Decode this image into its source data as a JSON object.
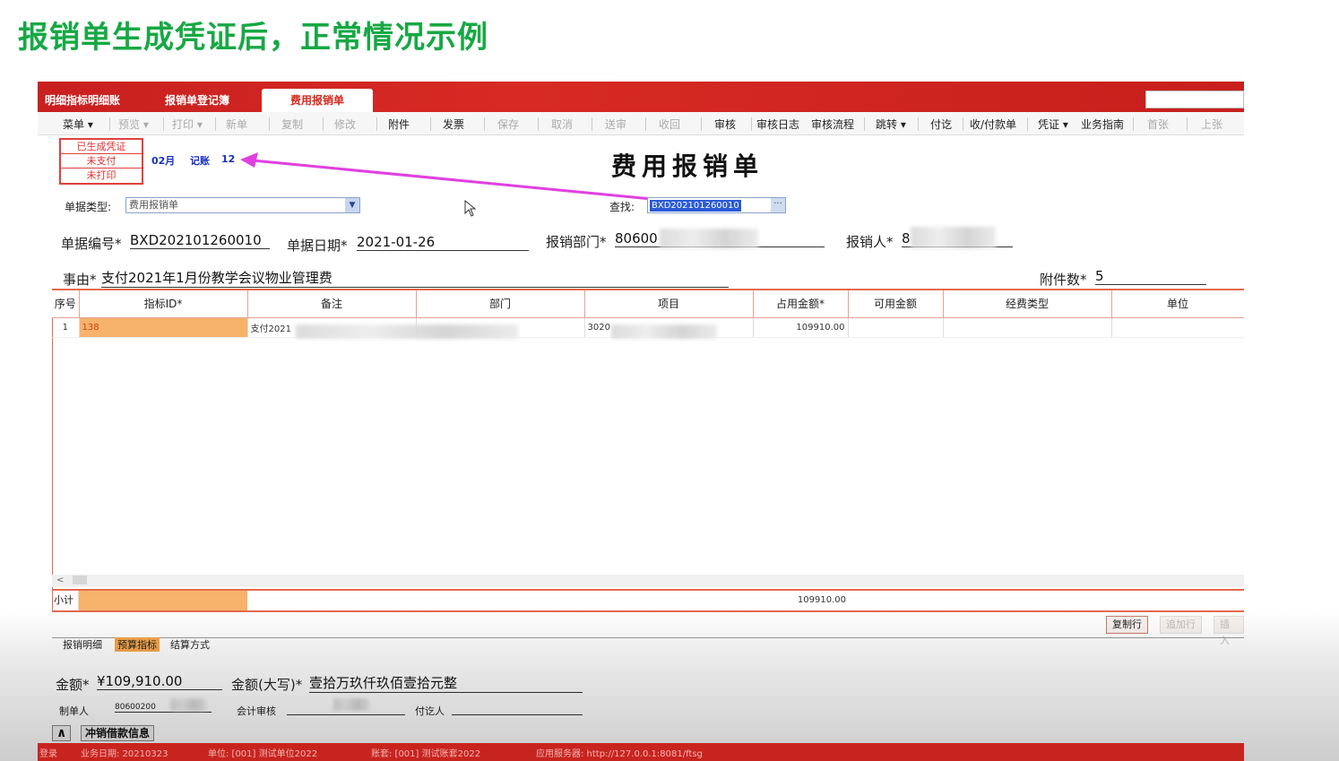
{
  "slide": {
    "title": "报销单生成凭证后，正常情况示例"
  },
  "tabs": [
    "明细指标明细账",
    "报销单登记簿",
    "费用报销单"
  ],
  "toolbar": {
    "items": [
      {
        "label": "菜单 ▾",
        "enabled": true
      },
      {
        "label": "预览 ▾",
        "enabled": false
      },
      {
        "label": "打印 ▾",
        "enabled": false
      },
      {
        "label": "新单",
        "enabled": false
      },
      {
        "label": "复制",
        "enabled": false
      },
      {
        "label": "修改",
        "enabled": false
      },
      {
        "label": "附件",
        "enabled": true
      },
      {
        "label": "发票",
        "enabled": true
      },
      {
        "label": "保存",
        "enabled": false
      },
      {
        "label": "取消",
        "enabled": false
      },
      {
        "label": "送审",
        "enabled": false
      },
      {
        "label": "收回",
        "enabled": false
      },
      {
        "label": "审核",
        "enabled": true
      },
      {
        "label": "审核日志",
        "enabled": true
      },
      {
        "label": "审核流程",
        "enabled": true
      },
      {
        "label": "跳转 ▾",
        "enabled": true
      },
      {
        "label": "付讫",
        "enabled": true
      },
      {
        "label": "收/付款单",
        "enabled": true
      },
      {
        "label": "凭证 ▾",
        "enabled": true
      },
      {
        "label": "业务指南",
        "enabled": true
      },
      {
        "label": "首张",
        "enabled": false
      },
      {
        "label": "上张",
        "enabled": false
      }
    ]
  },
  "status": [
    "已生成凭证",
    "未支付",
    "未打印"
  ],
  "voucher": {
    "month": "02月",
    "type": "记账",
    "number": "12"
  },
  "form": {
    "title": "费用报销单",
    "doc_type_label": "单据类型:",
    "doc_type_value": "费用报销单",
    "find_label": "查找:",
    "find_value": "BXD202101260010",
    "doc_no_label": "单据编号*",
    "doc_no": "BXD202101260010",
    "doc_date_label": "单据日期*",
    "doc_date": "2021-01-26",
    "dept_label": "报销部门*",
    "dept": "80600",
    "person_label": "报销人*",
    "person": "8",
    "reason_label": "事由*",
    "reason": "支付2021年1月份教学会议物业管理费",
    "attach_label": "附件数*",
    "attach_count": "5"
  },
  "grid": {
    "columns": [
      "序号",
      "指标ID*",
      "备注",
      "部门",
      "项目",
      "占用金额*",
      "可用金额",
      "经费类型",
      "单位"
    ],
    "rows": [
      {
        "seq": "1",
        "index_id": "138",
        "remark": "支付2021",
        "dept": "",
        "project": "3020",
        "amount": "109910.00",
        "available": "",
        "fund_type": "",
        "unit": ""
      }
    ],
    "subtotal_label": "小计",
    "subtotal_amount": "109910.00"
  },
  "row_buttons": [
    {
      "label": "复制行",
      "enabled": true
    },
    {
      "label": "追加行",
      "enabled": false
    },
    {
      "label": "插入",
      "enabled": false
    }
  ],
  "subtabs": [
    "报销明细",
    "预算指标",
    "结算方式"
  ],
  "footer": {
    "amount_label": "金额*",
    "amount": "¥109,910.00",
    "amount_cn_label": "金额(大写)*",
    "amount_cn": "壹拾万玖仟玖佰壹拾元整",
    "maker_label": "制单人",
    "maker": "80600200",
    "auditor_label": "会计审核",
    "payer_label": "付讫人",
    "collapse": "∧",
    "offset_label": "冲销借款信息"
  },
  "statusbar": {
    "text": [
      "登录",
      "业务日期: 20210323",
      "单位: [001] 测试单位2022",
      "账套: [001] 测试账套2022",
      "应用服务器: http://127.0.0.1:8081/ftsg"
    ]
  },
  "colors": {
    "brand_red": "#c8201f",
    "slide_green": "#17a844",
    "highlight_orange": "#f7b26c",
    "arrow_magenta": "#e040e0",
    "voucher_blue": "#1830c0"
  }
}
